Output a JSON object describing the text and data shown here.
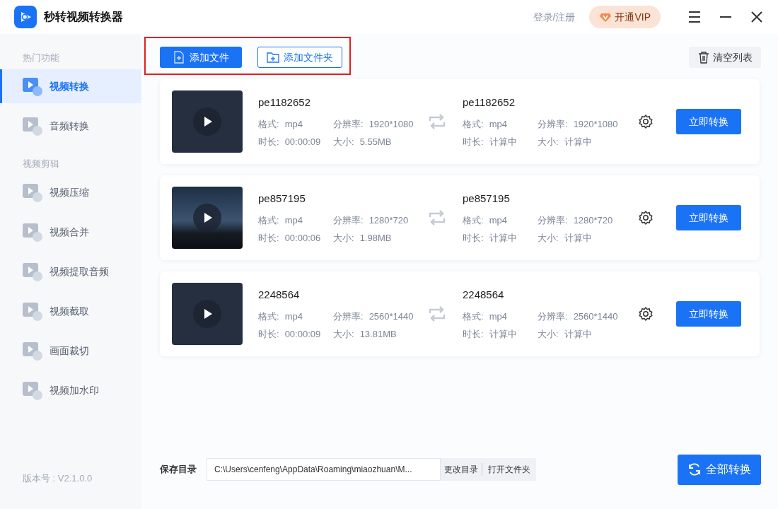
{
  "window": {
    "title": "秒转视频转换器",
    "login": "登录/注册",
    "vip": "开通VIP"
  },
  "sidebar": {
    "sections": [
      {
        "title": "热门功能",
        "items": [
          {
            "label": "视频转换",
            "selected": true
          },
          {
            "label": "音频转换",
            "selected": false
          }
        ]
      },
      {
        "title": "视频剪辑",
        "items": [
          {
            "label": "视频压缩",
            "selected": false
          },
          {
            "label": "视频合并",
            "selected": false
          },
          {
            "label": "视频提取音频",
            "selected": false
          },
          {
            "label": "视频截取",
            "selected": false
          },
          {
            "label": "画面裁切",
            "selected": false
          },
          {
            "label": "视频加水印",
            "selected": false
          }
        ]
      }
    ],
    "version": "版本号 : V2.1.0.0"
  },
  "toolbar": {
    "add_file": "添加文件",
    "add_folder": "添加文件夹",
    "clear": "清空列表"
  },
  "files": [
    {
      "kind": "plain",
      "name": "pe1182652",
      "format_label": "格式:",
      "format": "mp4",
      "resolution_label": "分辨率:",
      "resolution": "1920*1080",
      "duration_label": "时长:",
      "duration": "00:00:09",
      "size_label": "大小:",
      "size": "5.55MB",
      "output": {
        "name": "pe1182652",
        "format_label": "格式:",
        "format": "mp4",
        "resolution_label": "分辨率:",
        "resolution": "1920*1080",
        "duration_label": "时长:",
        "duration": "计算中",
        "size_label": "大小:",
        "size": "计算中"
      },
      "button": "立即转换"
    },
    {
      "kind": "photo",
      "name": "pe857195",
      "format_label": "格式:",
      "format": "mp4",
      "resolution_label": "分辨率:",
      "resolution": "1280*720",
      "duration_label": "时长:",
      "duration": "00:00:06",
      "size_label": "大小:",
      "size": "1.98MB",
      "output": {
        "name": "pe857195",
        "format_label": "格式:",
        "format": "mp4",
        "resolution_label": "分辨率:",
        "resolution": "1280*720",
        "duration_label": "时长:",
        "duration": "计算中",
        "size_label": "大小:",
        "size": "计算中"
      },
      "button": "立即转换"
    },
    {
      "kind": "plain",
      "name": "2248564",
      "format_label": "格式:",
      "format": "mp4",
      "resolution_label": "分辨率:",
      "resolution": "2560*1440",
      "duration_label": "时长:",
      "duration": "00:00:09",
      "size_label": "大小:",
      "size": "13.81MB",
      "output": {
        "name": "2248564",
        "format_label": "格式:",
        "format": "mp4",
        "resolution_label": "分辨率:",
        "resolution": "2560*1440",
        "duration_label": "时长:",
        "duration": "计算中",
        "size_label": "大小:",
        "size": "计算中"
      },
      "button": "立即转换"
    }
  ],
  "footer": {
    "label": "保存目录",
    "path": "C:\\Users\\cenfeng\\AppData\\Roaming\\miaozhuan\\M...",
    "change_dir": "更改目录",
    "open_folder": "打开文件夹",
    "convert_all": "全部转换"
  }
}
